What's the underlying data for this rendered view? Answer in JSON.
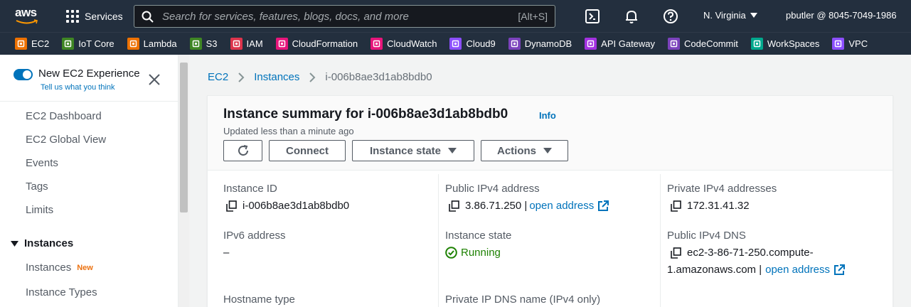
{
  "topnav": {
    "logo_text": "aws",
    "services_label": "Services",
    "search_placeholder": "Search for services, features, blogs, docs, and more",
    "search_shortcut": "[Alt+S]",
    "region": "N. Virginia",
    "account": "pbutler @ 8045-7049-1986"
  },
  "favorites": [
    {
      "label": "EC2",
      "color": "#ed7100",
      "icon": "ec2-icon"
    },
    {
      "label": "IoT Core",
      "color": "#3f8624",
      "icon": "iot-core-icon"
    },
    {
      "label": "Lambda",
      "color": "#ed7100",
      "icon": "lambda-icon"
    },
    {
      "label": "S3",
      "color": "#3f8624",
      "icon": "s3-icon"
    },
    {
      "label": "IAM",
      "color": "#dd344c",
      "icon": "iam-icon"
    },
    {
      "label": "CloudFormation",
      "color": "#e7157b",
      "icon": "cloudformation-icon"
    },
    {
      "label": "CloudWatch",
      "color": "#e7157b",
      "icon": "cloudwatch-icon"
    },
    {
      "label": "Cloud9",
      "color": "#8c4fff",
      "icon": "cloud9-icon"
    },
    {
      "label": "DynamoDB",
      "color": "#7b42bc",
      "icon": "dynamodb-icon"
    },
    {
      "label": "API Gateway",
      "color": "#a332e0",
      "icon": "api-gateway-icon"
    },
    {
      "label": "CodeCommit",
      "color": "#7b42bc",
      "icon": "codecommit-icon"
    },
    {
      "label": "WorkSpaces",
      "color": "#01a88d",
      "icon": "workspaces-icon"
    },
    {
      "label": "VPC",
      "color": "#8c4fff",
      "icon": "vpc-icon"
    }
  ],
  "sidebar": {
    "new_experience_title": "New EC2 Experience",
    "tell_us": "Tell us what you think",
    "items": [
      "EC2 Dashboard",
      "EC2 Global View",
      "Events",
      "Tags",
      "Limits"
    ],
    "section": "Instances",
    "section_items": [
      {
        "label": "Instances",
        "badge": "New"
      },
      {
        "label": "Instance Types",
        "badge": ""
      }
    ]
  },
  "breadcrumb": {
    "items": [
      "EC2",
      "Instances"
    ],
    "current": "i-006b8ae3d1ab8bdb0"
  },
  "summary": {
    "title": "Instance summary for i-006b8ae3d1ab8bdb0",
    "info": "Info",
    "updated": "Updated less than a minute ago",
    "buttons": {
      "connect": "Connect",
      "instance_state": "Instance state",
      "actions": "Actions"
    },
    "fields": {
      "instance_id_label": "Instance ID",
      "instance_id": "i-006b8ae3d1ab8bdb0",
      "ipv6_label": "IPv6 address",
      "ipv6": "–",
      "hostname_label": "Hostname type",
      "public_ipv4_label": "Public IPv4 address",
      "public_ipv4": "3.86.71.250 |",
      "open_address": "open address",
      "state_label": "Instance state",
      "state": "Running",
      "private_dns_label": "Private IP DNS name (IPv4 only)",
      "private_ipv4_label": "Private IPv4 addresses",
      "private_ipv4": "172.31.41.32",
      "public_dns_label": "Public IPv4 DNS",
      "public_dns_line1": "ec2-3-86-71-250.compute-",
      "public_dns_line2": "1.amazonaws.com |"
    }
  },
  "colors": {
    "nav_bg": "#232f3e",
    "link": "#0073bb",
    "running": "#1d8102",
    "new_badge": "#ec7211"
  }
}
